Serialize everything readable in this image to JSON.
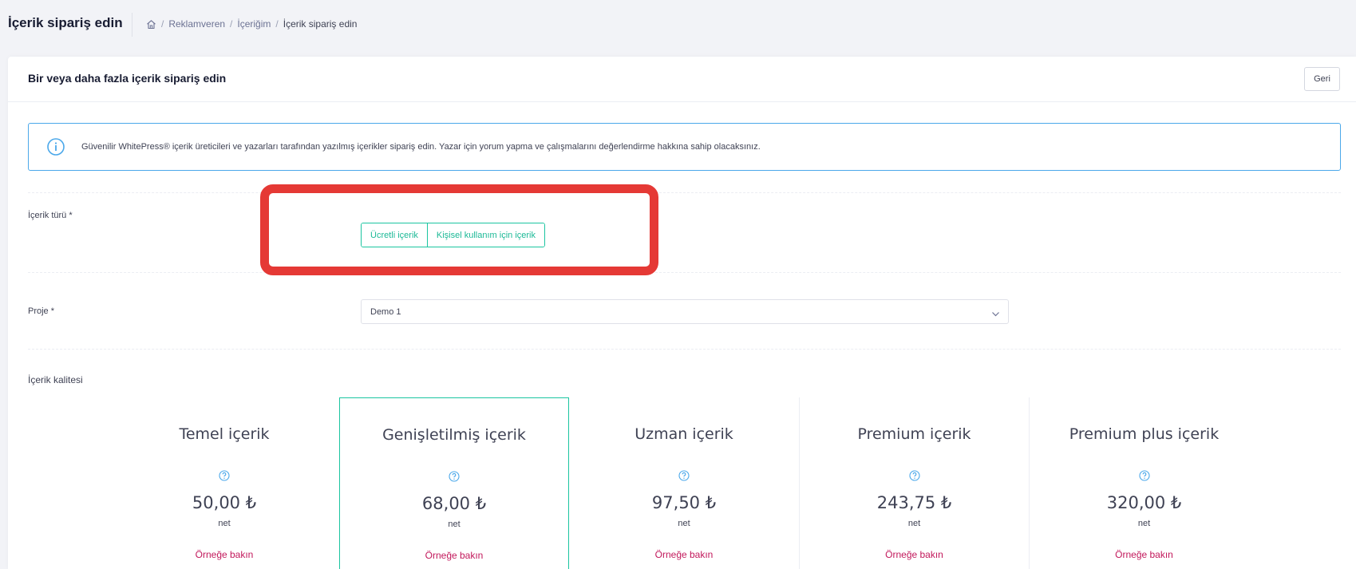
{
  "header": {
    "title": "İçerik sipariş edin",
    "breadcrumb": [
      "Reklamveren",
      "İçeriğim",
      "İçerik sipariş edin"
    ],
    "separator": "/"
  },
  "card": {
    "title": "Bir veya daha fazla içerik sipariş edin",
    "back_label": "Geri"
  },
  "info": {
    "text": "Güvenilir WhitePress® içerik üreticileri ve yazarları tarafından yazılmış içerikler sipariş edin. Yazar için yorum yapma ve çalışmalarını değerlendirme hakkına sahip olacaksınız."
  },
  "content_type": {
    "label": "İçerik türü *",
    "options": [
      "Ücretli içerik",
      "Kişisel kullanım için içerik"
    ]
  },
  "project": {
    "label": "Proje *",
    "value": "Demo 1"
  },
  "quality": {
    "label": "İçerik kalitesi",
    "tiers": [
      {
        "name": "Temel içerik",
        "price": "50,00 ₺",
        "net": "net",
        "example": "Örneğe bakın"
      },
      {
        "name": "Genişletilmiş içerik",
        "price": "68,00 ₺",
        "net": "net",
        "example": "Örneğe bakın"
      },
      {
        "name": "Uzman içerik",
        "price": "97,50 ₺",
        "net": "net",
        "example": "Örneğe bakın"
      },
      {
        "name": "Premium içerik",
        "price": "243,75 ₺",
        "net": "net",
        "example": "Örneğe bakın"
      },
      {
        "name": "Premium plus içerik",
        "price": "320,00 ₺",
        "net": "net",
        "example": "Örneğe bakın"
      }
    ]
  },
  "colors": {
    "accent": "#1bc5a0",
    "info": "#4ba8ea",
    "highlight": "#e53935",
    "link": "#c2185b"
  }
}
